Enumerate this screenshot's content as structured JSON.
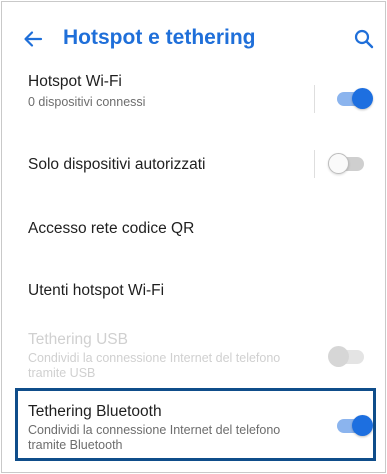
{
  "header": {
    "title": "Hotspot e tethering",
    "back_icon": "arrow-back-icon",
    "search_icon": "search-icon"
  },
  "settings": [
    {
      "title": "Hotspot Wi-Fi",
      "subtitle": "0 dispositivi connessi",
      "toggle": "on"
    },
    {
      "title": "Solo dispositivi autorizzati",
      "toggle": "off"
    },
    {
      "title": "Accesso rete codice QR"
    },
    {
      "title": "Utenti hotspot Wi-Fi"
    },
    {
      "title": "Tethering USB",
      "subtitle": "Condividi la connessione Internet del telefono tramite USB",
      "toggle": "disabled"
    },
    {
      "title": "Tethering Bluetooth",
      "subtitle": "Condividi la connessione Internet del telefono tramite Bluetooth",
      "toggle": "on",
      "highlighted": true
    }
  ],
  "colors": {
    "accent": "#1f6fd9",
    "toggle_on_thumb": "#1d6fe0",
    "toggle_on_track": "#8bb4ee",
    "highlight_border": "#0f4d8a",
    "disabled_text": "#d0d0d0"
  }
}
